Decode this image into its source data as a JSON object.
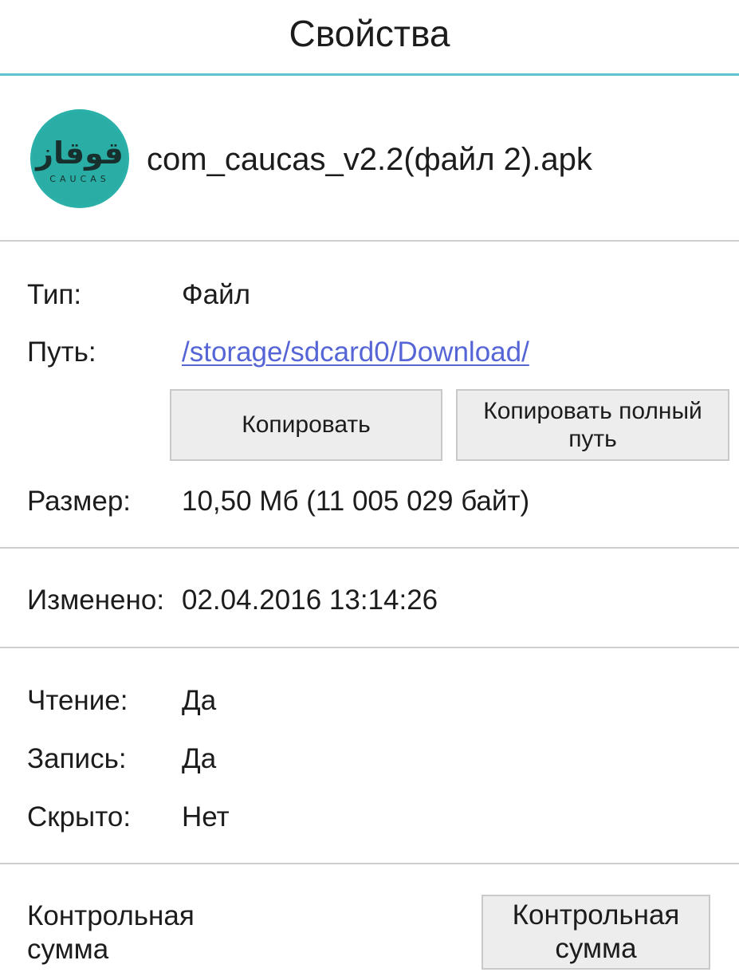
{
  "header": {
    "title": "Свойства"
  },
  "file": {
    "name": "com_caucas_v2.2(файл 2).apk",
    "icon": {
      "name": "caucas-app-icon",
      "arabic_text": "قوقاز",
      "latin_text": "CAUCAS",
      "color": "#2ab0a8"
    }
  },
  "properties": {
    "type": {
      "label": "Тип:",
      "value": "Файл"
    },
    "path": {
      "label": "Путь:",
      "value": "/storage/sdcard0/Download/"
    },
    "size": {
      "label": "Размер:",
      "value": "10,50 Мб (11 005 029 байт)"
    },
    "modified": {
      "label": "Изменено:",
      "value": "02.04.2016 13:14:26"
    },
    "read": {
      "label": "Чтение:",
      "value": "Да"
    },
    "write": {
      "label": "Запись:",
      "value": "Да"
    },
    "hidden": {
      "label": "Скрыто:",
      "value": "Нет"
    }
  },
  "buttons": {
    "copy": "Копировать",
    "copy_full_path": "Копировать полный путь",
    "checksum": "Контрольная сумма"
  },
  "checksum": {
    "label": "Контрольная сумма"
  },
  "colors": {
    "accent_line": "#5fc3d2",
    "link": "#5565d6",
    "divider": "#cfcfcf",
    "button_bg": "#ededed"
  }
}
